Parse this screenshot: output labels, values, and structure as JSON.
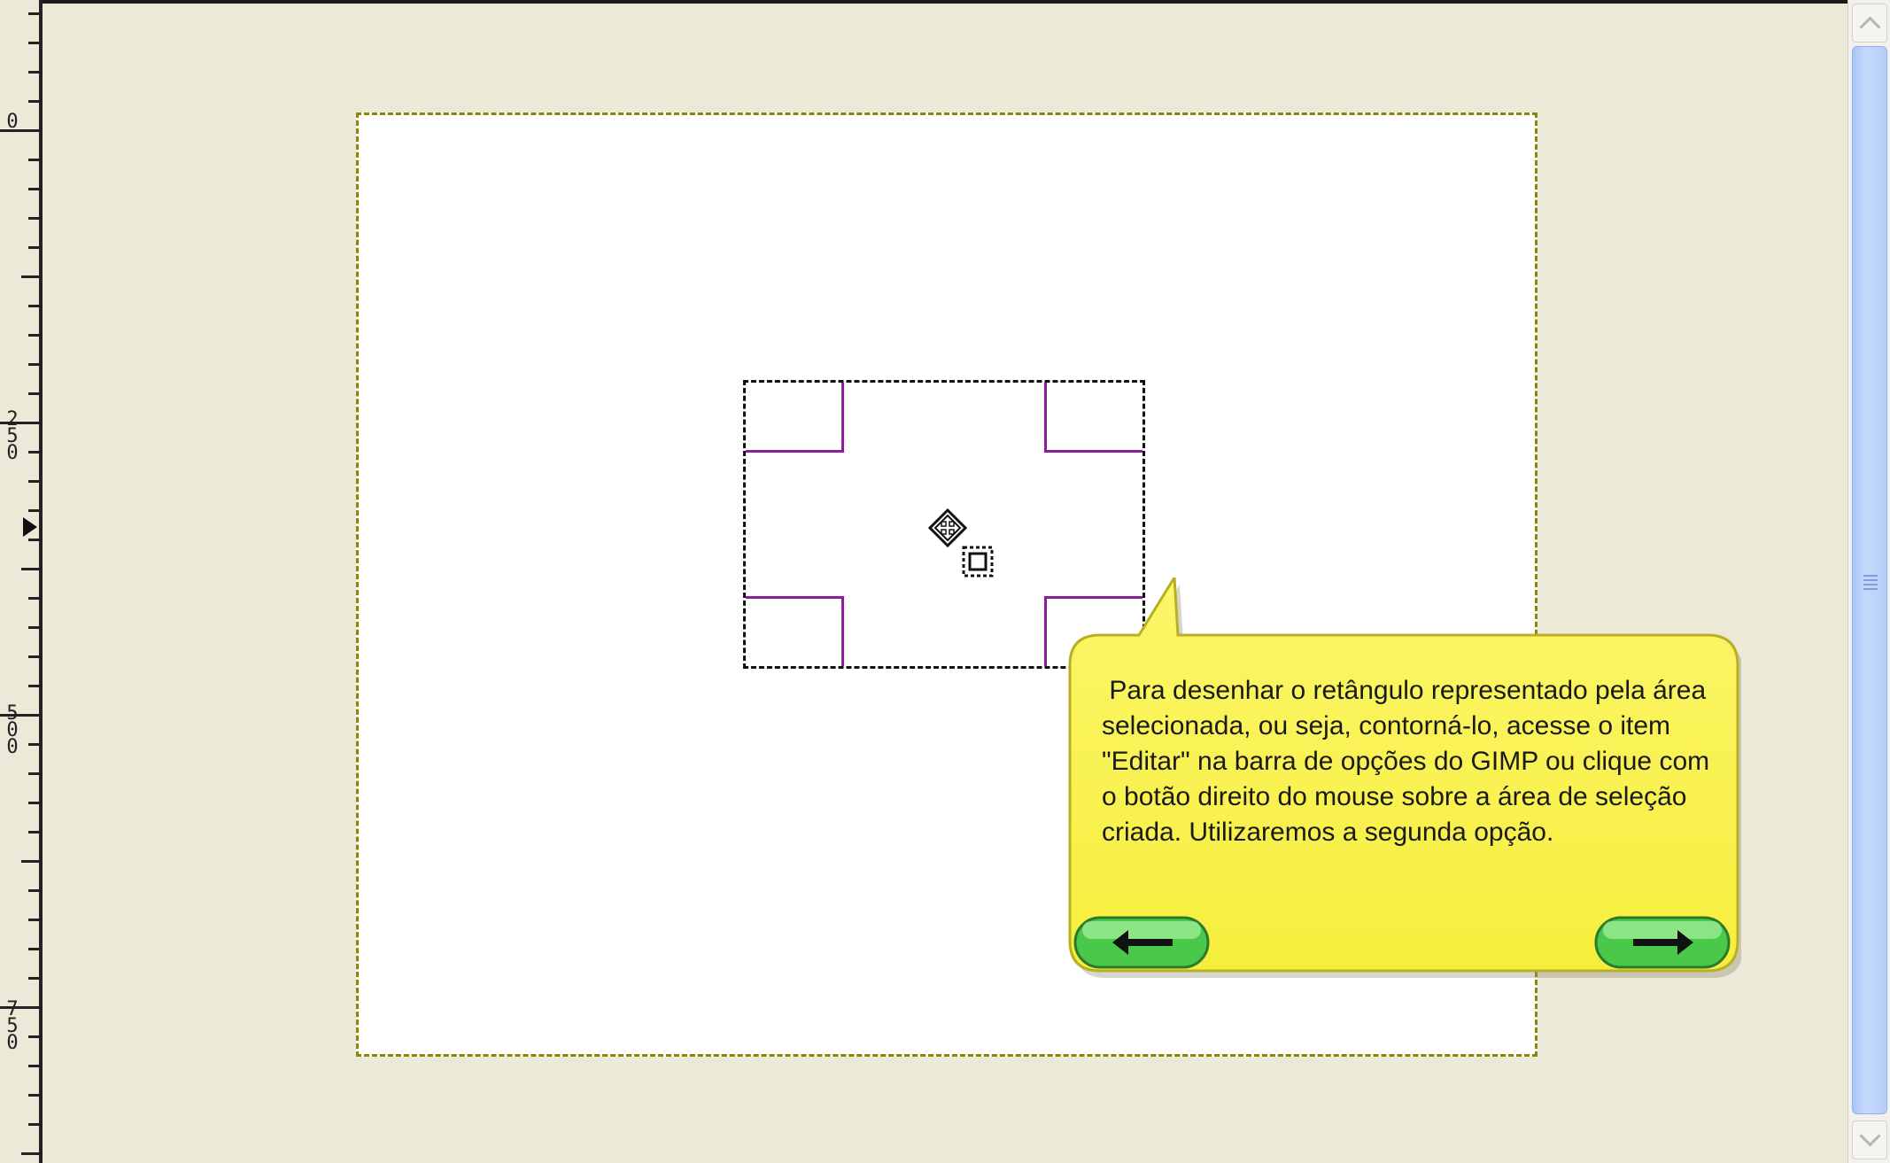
{
  "ruler": {
    "labels": [
      "0",
      "250",
      "500",
      "750"
    ]
  },
  "tooltip": {
    "text": " Para desenhar o retângulo representado pela área selecionada, ou seja, contorná-lo, acesse o item \"Editar\" na barra de opções do GIMP ou clique com o botão direito do mouse sobre a área de seleção criada. Utilizaremos a segunda opção.",
    "prev_icon": "arrow-left-icon",
    "next_icon": "arrow-right-icon"
  },
  "colors": {
    "canvas_bg": "#ece9d8",
    "selection_handles": "#8e1c9e",
    "tooltip_fill": "#fdf65a",
    "nav_button": "#5fdc5f"
  }
}
